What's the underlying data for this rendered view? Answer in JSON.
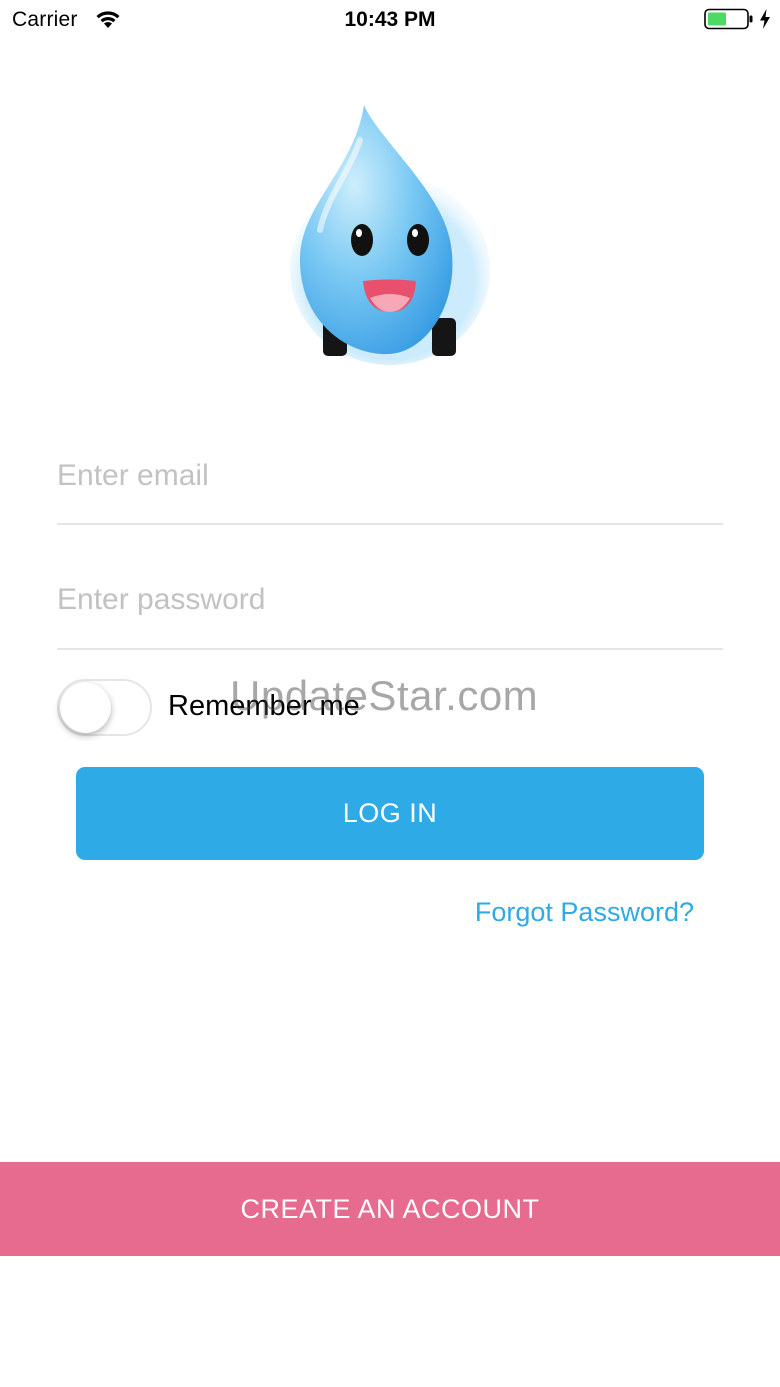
{
  "status_bar": {
    "carrier": "Carrier",
    "time": "10:43 PM",
    "battery_color": "#4cd964"
  },
  "logo": {
    "icon": "water-drop-mascot-icon",
    "color": "#3aa7e8"
  },
  "login_form": {
    "email_placeholder": "Enter email",
    "email_value": "",
    "password_placeholder": "Enter password",
    "password_value": "",
    "remember_label": "Remember me",
    "remember_on": false,
    "login_label": "LOG IN",
    "forgot_label": "Forgot Password?"
  },
  "footer": {
    "create_label": "CREATE AN ACCOUNT"
  },
  "watermark": "UpdateStar.com",
  "colors": {
    "accent_blue": "#2eaae6",
    "accent_pink": "#e76b8f",
    "placeholder": "#c2c2c2"
  }
}
